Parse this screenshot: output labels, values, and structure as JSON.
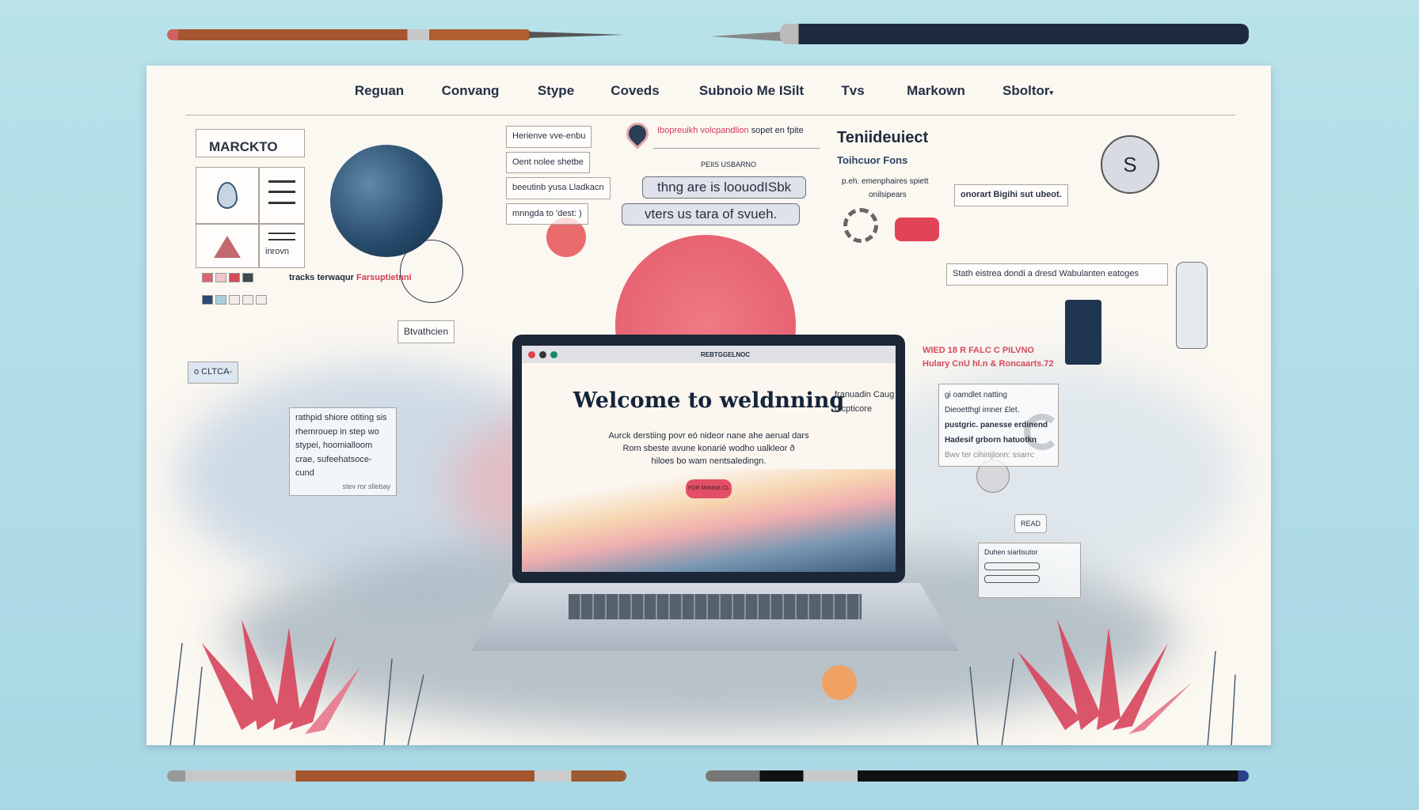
{
  "nav": {
    "items": [
      "Reguan",
      "Convang",
      "Stype",
      "Coveds",
      "Subnoio Me ISilt",
      "Tvs",
      "Markown",
      "Sboltor"
    ],
    "caret": "▾"
  },
  "left_panel": {
    "logo": "MARCKTO",
    "row2_label": "inrovn",
    "swatch_label_a": "tracks terwaqur",
    "swatch_label_b": "Farsuptietnni",
    "swatch_colors": [
      "#d8676f",
      "#f2c4cb",
      "#d44c5a",
      "#3f4a4a",
      "#2e4a72",
      "#a8cfe0",
      "#f1ecea",
      "#f1ecea",
      "#f1ecea"
    ],
    "button": "Btvathcien",
    "tag": "o  CLTCA-"
  },
  "center_top": {
    "list": [
      "Herienve vve-enbu",
      "Oent nolee shetbe",
      "beeutinb yusa Lladkacn",
      "mnngda to 'dest: )"
    ],
    "headline_red": "Ibopreuikh volcpandlion",
    "headline_rest": "sopet en fpite",
    "caption": "PEIIS USBARNO",
    "pill1": "thng are is loouodISbk",
    "pill2": "vters us tara of svueh."
  },
  "right_top": {
    "title": "Teniideuiect",
    "subtitle": "Toihcuor Fons",
    "bullets": [
      "emenphaires spiett",
      "onilsipears"
    ],
    "bullet_marker": "p.eh.",
    "box1": "onorart Bigihi sut ubeot.",
    "box2": "Stath eistrea dondi a dresd Wabulanten eatoges",
    "red_line1": "WIED 18 R FALC C PILVNO",
    "red_line2": "Hulary CnU hl.n & Roncaarts.72"
  },
  "laptop": {
    "window_title": "REBTGGELNOC",
    "heading": "Welcome to weldnning",
    "body": [
      "Aurck derstiing povr eó nideor nane ahe aerual dars",
      "Rom sbeste avune konarié wodho ualkleor ð",
      "hiloes bo wam nentsaledingn."
    ],
    "cta": "FOR MIRINE.CL"
  },
  "left_bottom": {
    "note": [
      "rathpid shiore otiting sis",
      "rhemrouep in step wo",
      "stypei, hoomialloom",
      "crae, sufeehatsoce-cund"
    ],
    "footer": "stev ror sllebay"
  },
  "right_bottom": {
    "small_note": [
      "franuadin Caug",
      "dicpticore"
    ],
    "card": [
      "gi oamdlet natting",
      "Dieoetthgl imner £let.",
      "pustgric. panesse erdinend",
      "Hadesif grborn hatuotkn",
      "Bwv ter cihinijlonn: ssarrc"
    ],
    "tag": "READ",
    "form_label": "Duhen siarlisutor"
  },
  "colors": {
    "background": "#b5dfe8",
    "paper": "#fbf7f1",
    "accent_red": "#e0485e",
    "navy": "#23394f"
  }
}
